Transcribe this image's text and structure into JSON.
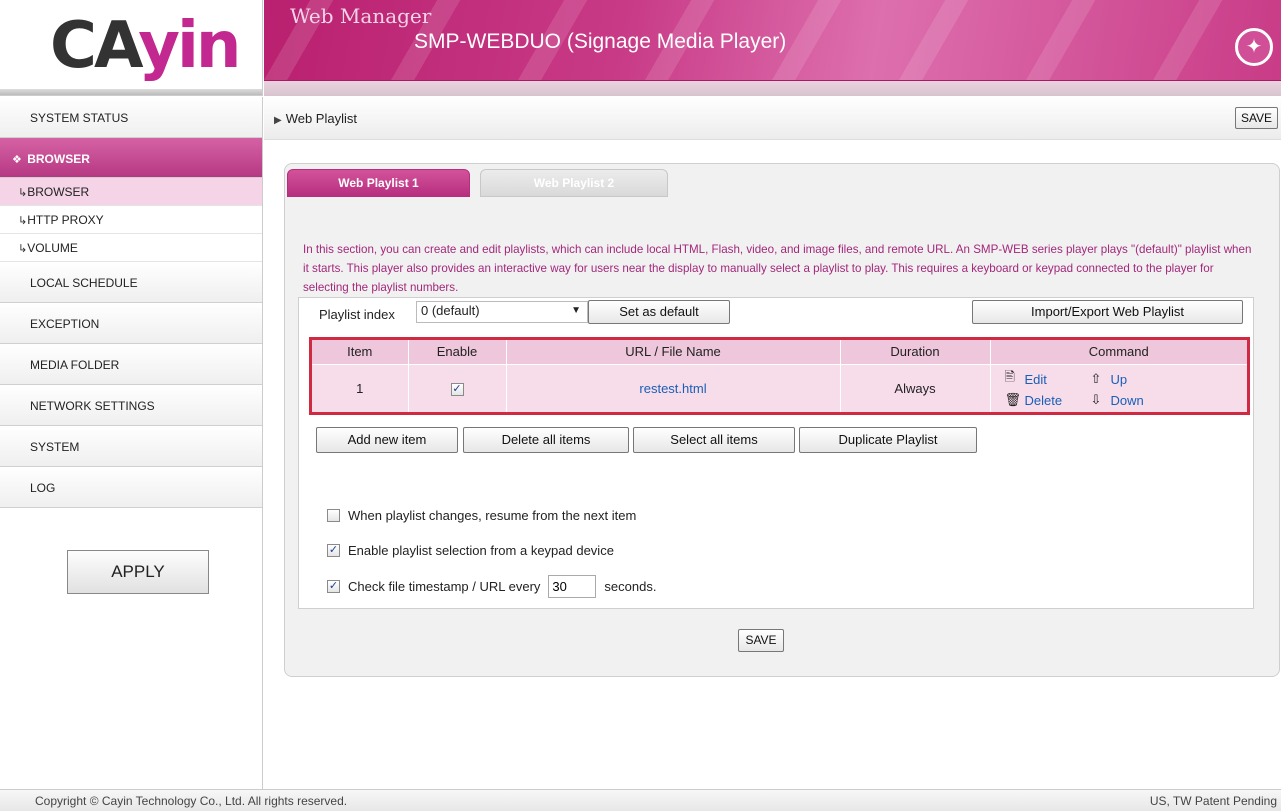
{
  "brand": {
    "logo_ca": "CA",
    "logo_yin": "yin",
    "app_title": "Web Manager",
    "device_title": "SMP-WEBDUO (Signage Media Player)"
  },
  "sidebar": {
    "items": [
      {
        "label": "SYSTEM STATUS"
      },
      {
        "label": "BROWSER"
      },
      {
        "label": "LOCAL SCHEDULE"
      },
      {
        "label": "EXCEPTION"
      },
      {
        "label": "MEDIA FOLDER"
      },
      {
        "label": "NETWORK SETTINGS"
      },
      {
        "label": "SYSTEM"
      },
      {
        "label": "LOG"
      }
    ],
    "sub_items": [
      {
        "label": "BROWSER"
      },
      {
        "label": "HTTP PROXY"
      },
      {
        "label": "VOLUME"
      }
    ],
    "sub_hook": "↳",
    "apply_label": "APPLY"
  },
  "breadcrumb": {
    "label": "Web Playlist"
  },
  "toolbar": {
    "save_label": "SAVE"
  },
  "tabs": [
    {
      "label": "Web Playlist 1"
    },
    {
      "label": "Web Playlist 2"
    }
  ],
  "description": "In this section, you can create and edit playlists, which can include local HTML, Flash, video, and image files, and remote URL. An SMP-WEB series player plays \"(default)\" playlist when it starts. This player also provides an interactive way for users near the display to manually select a playlist to play. This requires a keyboard or keypad connected to the player for selecting the playlist numbers.",
  "playlist_controls": {
    "index_label": "Playlist index",
    "index_value": "0 (default)",
    "set_default_label": "Set as default",
    "import_export_label": "Import/Export Web Playlist"
  },
  "table": {
    "headers": [
      "Item",
      "Enable",
      "URL / File Name",
      "Duration",
      "Command"
    ],
    "rows": [
      {
        "item": "1",
        "enabled_mark": "✓",
        "file": "restest.html",
        "duration": "Always",
        "cmd_edit": "Edit",
        "cmd_delete": "Delete",
        "cmd_up": "Up",
        "cmd_down": "Down"
      }
    ]
  },
  "actions": {
    "add_new": "Add new item",
    "delete_all": "Delete all items",
    "select_all": "Select all items",
    "duplicate": "Duplicate Playlist"
  },
  "options": {
    "resume_label": "When playlist changes, resume from the next item",
    "resume_checked": false,
    "keypad_label": "Enable playlist selection from a keypad device",
    "keypad_checked": true,
    "timestamp_label": "Check file timestamp / URL every",
    "timestamp_checked": true,
    "timestamp_value": "30",
    "timestamp_unit": "seconds."
  },
  "bottom": {
    "save_label": "SAVE"
  },
  "footer": {
    "copyright": "Copyright © Cayin Technology Co., Ltd. All rights reserved.",
    "patent": "US, TW Patent Pending"
  },
  "colors": {
    "brand_magenta": "#c2288f",
    "highlight_red": "#d02a42",
    "link_blue": "#1a5fb7"
  }
}
